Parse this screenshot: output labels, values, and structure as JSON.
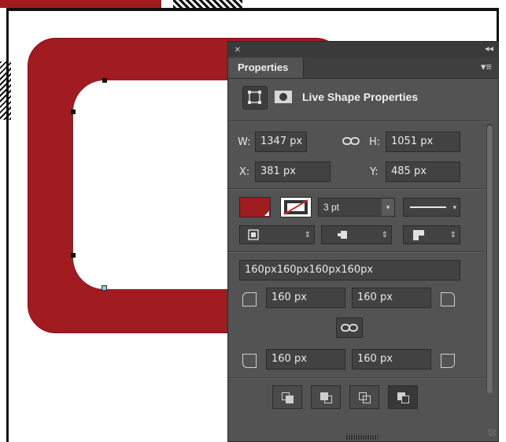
{
  "panel": {
    "close_glyph": "×",
    "collapse_glyph": "◂◂",
    "tab_label": "Properties",
    "menu_glyph": "▾≡",
    "heading": "Live Shape Properties"
  },
  "transform": {
    "w_label": "W:",
    "w_value": "1347 px",
    "h_label": "H:",
    "h_value": "1051 px",
    "x_label": "X:",
    "x_value": "381 px",
    "y_label": "Y:",
    "y_value": "485 px",
    "link_glyph": "⛓"
  },
  "appearance": {
    "fill_color": "#a01c20",
    "stroke_width": "3 pt"
  },
  "corners": {
    "summary": "160px160px160px160px",
    "top_left": "160 px",
    "top_right": "160 px",
    "bottom_left": "160 px",
    "bottom_right": "160 px",
    "link_glyph": "⛓"
  },
  "colors": {
    "accent_red": "#a01c20",
    "panel_bg": "#535353"
  }
}
